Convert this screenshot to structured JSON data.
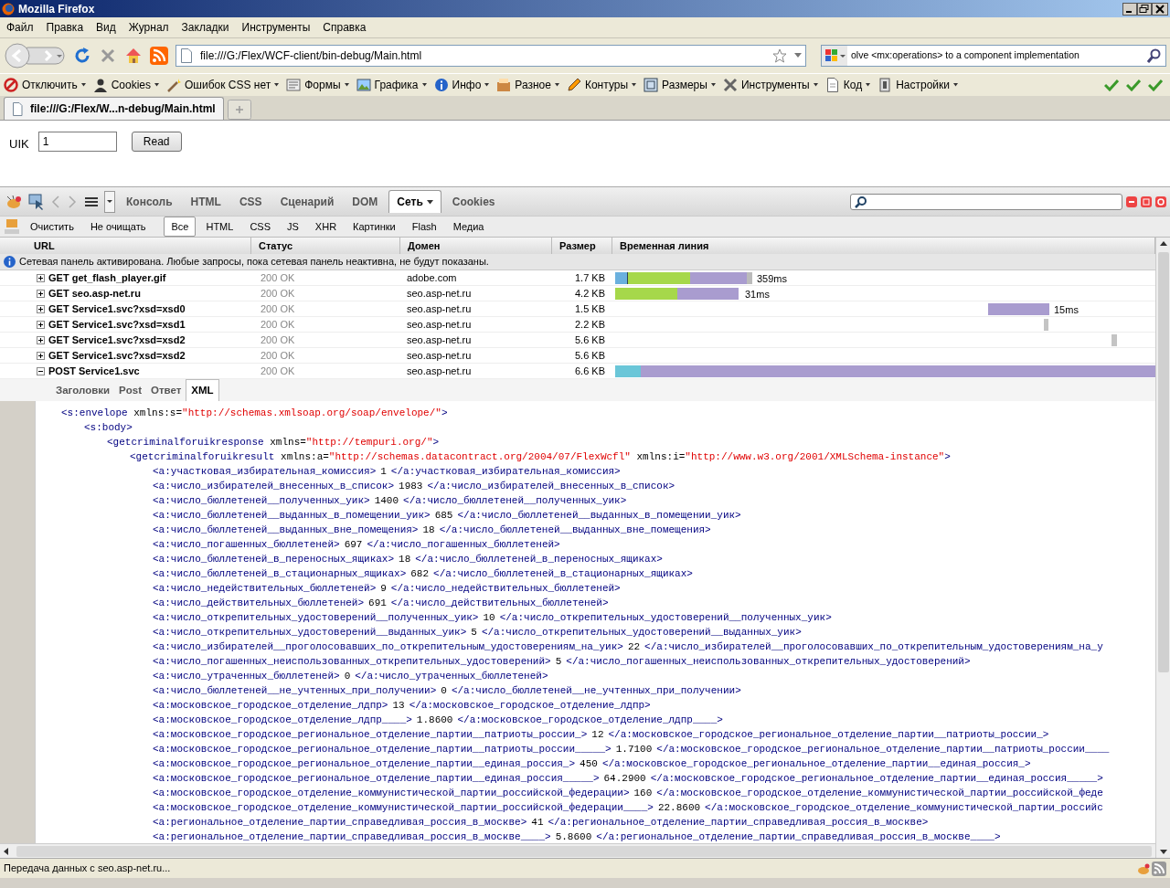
{
  "window": {
    "title": "Mozilla Firefox"
  },
  "menu": [
    "Файл",
    "Правка",
    "Вид",
    "Журнал",
    "Закладки",
    "Инструменты",
    "Справка"
  ],
  "address": {
    "value": "file:///G:/Flex/WCF-client/bin-debug/Main.html"
  },
  "search": {
    "value": "olve <mx:operations> to a component implementation"
  },
  "webdev_toolbar": [
    "Отключить",
    "Cookies",
    "Ошибок CSS нет",
    "Формы",
    "Графика",
    "Инфо",
    "Разное",
    "Контуры",
    "Размеры",
    "Инструменты",
    "Код",
    "Настройки"
  ],
  "tabs": [
    {
      "label": "file:///G:/Flex/W...n-debug/Main.html",
      "selected": true
    }
  ],
  "page": {
    "label": "UIK",
    "field_value": "1",
    "button": "Read"
  },
  "firebug": {
    "tabs": [
      {
        "label": "Консоль",
        "selected": false
      },
      {
        "label": "HTML",
        "selected": false
      },
      {
        "label": "CSS",
        "selected": false
      },
      {
        "label": "Сценарий",
        "selected": false
      },
      {
        "label": "DOM",
        "selected": false
      },
      {
        "label": "Сеть",
        "selected": true
      },
      {
        "label": "Cookies",
        "selected": false
      }
    ]
  },
  "net_toolbar": {
    "actions": [
      "Очистить",
      "Не очищать"
    ],
    "filters": [
      {
        "label": "Все",
        "selected": true
      },
      {
        "label": "HTML",
        "selected": false
      },
      {
        "label": "CSS",
        "selected": false
      },
      {
        "label": "JS",
        "selected": false
      },
      {
        "label": "XHR",
        "selected": false
      },
      {
        "label": "Картинки",
        "selected": false
      },
      {
        "label": "Flash",
        "selected": false
      },
      {
        "label": "Медиа",
        "selected": false
      }
    ]
  },
  "table": {
    "columns": [
      "URL",
      "Статус",
      "Домен",
      "Размер",
      "Временная линия"
    ],
    "info": "Сетевая панель активирована. Любые запросы, пока сетевая панель неактивна, не будут показаны.",
    "rows": [
      {
        "request": "GET get_flash_player.gif",
        "status": "200 OK",
        "domain": "adobe.com",
        "size": "1.7 KB",
        "time": "359ms",
        "expanded": false
      },
      {
        "request": "GET seo.asp-net.ru",
        "status": "200 OK",
        "domain": "seo.asp-net.ru",
        "size": "4.2 KB",
        "time": "31ms",
        "expanded": false
      },
      {
        "request": "GET Service1.svc?xsd=xsd0",
        "status": "200 OK",
        "domain": "seo.asp-net.ru",
        "size": "1.5 KB",
        "time": "15ms",
        "expanded": false
      },
      {
        "request": "GET Service1.svc?xsd=xsd1",
        "status": "200 OK",
        "domain": "seo.asp-net.ru",
        "size": "2.2 KB",
        "expanded": false
      },
      {
        "request": "GET Service1.svc?xsd=xsd2",
        "status": "200 OK",
        "domain": "seo.asp-net.ru",
        "size": "5.6 KB",
        "expanded": false
      },
      {
        "request": "GET Service1.svc?xsd=xsd2",
        "status": "200 OK",
        "domain": "seo.asp-net.ru",
        "size": "5.6 KB",
        "expanded": false
      },
      {
        "request": "POST Service1.svc",
        "status": "200 OK",
        "domain": "seo.asp-net.ru",
        "size": "6.6 KB",
        "expanded": true
      }
    ]
  },
  "detail_tabs": [
    {
      "label": "Заголовки",
      "selected": false
    },
    {
      "label": "Post",
      "selected": false
    },
    {
      "label": "Ответ",
      "selected": false
    },
    {
      "label": "XML",
      "selected": true
    }
  ],
  "xml": [
    {
      "tag": "<s:envelope",
      "attrs": [
        {
          "name": "xmlns:s=",
          "value": "\"http://schemas.xmlsoap.org/soap/envelope/\""
        }
      ],
      "end": ">",
      "children": [
        {
          "tag": "<s:body",
          "end": ">",
          "children": [
            {
              "tag": "<getcriminalforuikresponse",
              "attrs": [
                {
                  "name": "xmlns=",
                  "value": "\"http://tempuri.org/\""
                }
              ],
              "end": ">",
              "children": [
                {
                  "tag": "<getcriminalforuikresult",
                  "attrs": [
                    {
                      "name": "xmlns:a=",
                      "value": "\"http://schemas.datacontract.org/2004/07/FlexWcfl\""
                    },
                    {
                      "name": "xmlns:i=",
                      "value": "\"http://www.w3.org/2001/XMLSchema-instance\""
                    }
                  ],
                  "end": ">",
                  "children": [
                    {
                      "open": "<a:участковая_избирательная_комиссия>",
                      "value": "1",
                      "close": "</a:участковая_избирательная_комиссия>"
                    },
                    {
                      "open": "<a:число_избирателей_внесенных_в_список>",
                      "value": "1983",
                      "close": "</a:число_избирателей_внесенных_в_список>"
                    },
                    {
                      "open": "<a:число_бюллетеней__полученных_уик>",
                      "value": "1400",
                      "close": "</a:число_бюллетеней__полученных_уик>"
                    },
                    {
                      "open": "<a:число_бюллетеней__выданных_в_помещении_уик>",
                      "value": "685",
                      "close": "</a:число_бюллетеней__выданных_в_помещении_уик>"
                    },
                    {
                      "open": "<a:число_бюллетеней__выданных_вне_помещения>",
                      "value": "18",
                      "close": "</a:число_бюллетеней__выданных_вне_помещения>"
                    },
                    {
                      "open": "<a:число_погашенных_бюллетеней>",
                      "value": "697",
                      "close": "</a:число_погашенных_бюллетеней>"
                    },
                    {
                      "open": "<a:число_бюллетеней_в_переносных_ящиках>",
                      "value": "18",
                      "close": "</a:число_бюллетеней_в_переносных_ящиках>"
                    },
                    {
                      "open": "<a:число_бюллетеней_в_стационарных_ящиках>",
                      "value": "682",
                      "close": "</a:число_бюллетеней_в_стационарных_ящиках>"
                    },
                    {
                      "open": "<a:число_недействительных_бюллетеней>",
                      "value": "9",
                      "close": "</a:число_недействительных_бюллетеней>"
                    },
                    {
                      "open": "<a:число_действительных_бюллетеней>",
                      "value": "691",
                      "close": "</a:число_действительных_бюллетеней>"
                    },
                    {
                      "open": "<a:число_открепительных_удостоверений__полученных_уик>",
                      "value": "10",
                      "close": "</a:число_открепительных_удостоверений__полученных_уик>"
                    },
                    {
                      "open": "<a:число_открепительных_удостоверений__выданных_уик>",
                      "value": "5",
                      "close": "</a:число_открепительных_удостоверений__выданных_уик>"
                    },
                    {
                      "open": "<a:число_избирателей__проголосовавших_по_открепительным_удостоверениям_на_уик>",
                      "value": "22",
                      "close": "</a:число_избирателей__проголосовавших_по_открепительным_удостоверениям_на_у"
                    },
                    {
                      "open": "<a:число_погашенных_неиспользованных_открепительных_удостоверений>",
                      "value": "5",
                      "close": "</a:число_погашенных_неиспользованных_открепительных_удостоверений>"
                    },
                    {
                      "open": "<a:число_утраченных_бюллетеней>",
                      "value": "0",
                      "close": "</a:число_утраченных_бюллетеней>"
                    },
                    {
                      "open": "<a:число_бюллетеней__не_учтенных_при_получении>",
                      "value": "0",
                      "close": "</a:число_бюллетеней__не_учтенных_при_получении>"
                    },
                    {
                      "open": "<a:московское_городское_отделение_лдпр>",
                      "value": "13",
                      "close": "</a:московское_городское_отделение_лдпр>"
                    },
                    {
                      "open": "<a:московское_городское_отделение_лдпр____>",
                      "value": "1.8600",
                      "close": "</a:московское_городское_отделение_лдпр____>"
                    },
                    {
                      "open": "<a:московское_городское_региональное_отделение_партии__патриоты_россии_>",
                      "value": "12",
                      "close": "</a:московское_городское_региональное_отделение_партии__патриоты_россии_>"
                    },
                    {
                      "open": "<a:московское_городское_региональное_отделение_партии__патриоты_россии_____>",
                      "value": "1.7100",
                      "close": "</a:московское_городское_региональное_отделение_партии__патриоты_россии____"
                    },
                    {
                      "open": "<a:московское_городское_региональное_отделение_партии__единая_россия_>",
                      "value": "450",
                      "close": "</a:московское_городское_региональное_отделение_партии__единая_россия_>"
                    },
                    {
                      "open": "<a:московское_городское_региональное_отделение_партии__единая_россия_____>",
                      "value": "64.2900",
                      "close": "</a:московское_городское_региональное_отделение_партии__единая_россия_____>"
                    },
                    {
                      "open": "<a:московское_городское_отделение_коммунистической_партии_российской_федерации>",
                      "value": "160",
                      "close": "</a:московское_городское_отделение_коммунистической_партии_российской_феде"
                    },
                    {
                      "open": "<a:московское_городское_отделение_коммунистической_партии_российской_федерации____>",
                      "value": "22.8600",
                      "close": "</a:московское_городское_отделение_коммунистической_партии_российс"
                    },
                    {
                      "open": "<a:региональное_отделение_партии_справедливая_россия_в_москве>",
                      "value": "41",
                      "close": "</a:региональное_отделение_партии_справедливая_россия_в_москве>"
                    },
                    {
                      "open": "<a:региональное_отделение_партии_справедливая_россия_в_москве____>",
                      "value": "5.8600",
                      "close": "</a:региональное_отделение_партии_справедливая_россия_в_москве____>"
                    }
                  ]
                }
              ]
            }
          ]
        }
      ]
    }
  ],
  "status_bar": "Передача данных с seo.asp-net.ru..."
}
